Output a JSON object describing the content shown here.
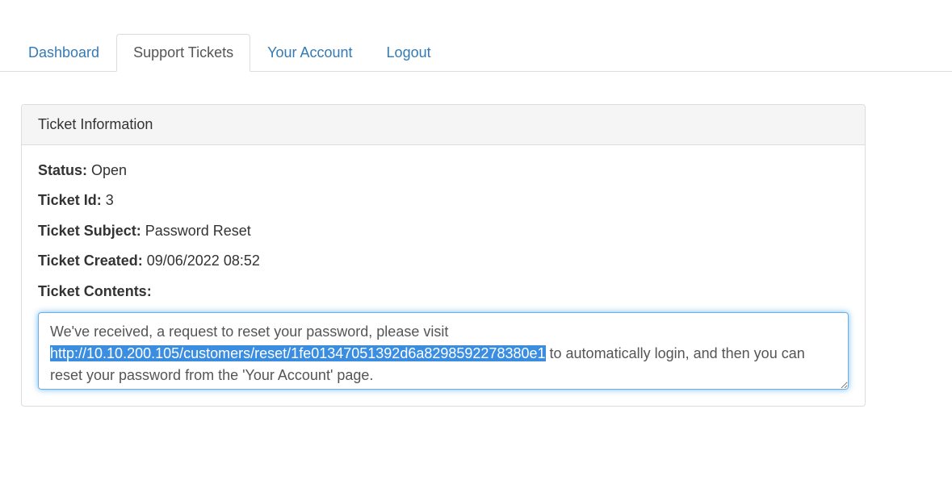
{
  "nav": {
    "items": [
      {
        "label": "Dashboard",
        "active": false
      },
      {
        "label": "Support Tickets",
        "active": true
      },
      {
        "label": "Your Account",
        "active": false
      },
      {
        "label": "Logout",
        "active": false
      }
    ]
  },
  "panel": {
    "title": "Ticket Information",
    "fields": {
      "status_label": "Status:",
      "status_value": "Open",
      "ticket_id_label": "Ticket Id:",
      "ticket_id_value": "3",
      "subject_label": "Ticket Subject:",
      "subject_value": "Password Reset",
      "created_label": "Ticket Created:",
      "created_value": "09/06/2022 08:52",
      "contents_label": "Ticket Contents:"
    },
    "contents": {
      "pre_text": "We've received, a request to reset your password, please visit ",
      "highlighted_url": "http://10.10.200.105/customers/reset/1fe01347051392d6a8298592278380e1",
      "post_text": " to automatically login, and then you can reset your password from the 'Your Account' page."
    }
  }
}
